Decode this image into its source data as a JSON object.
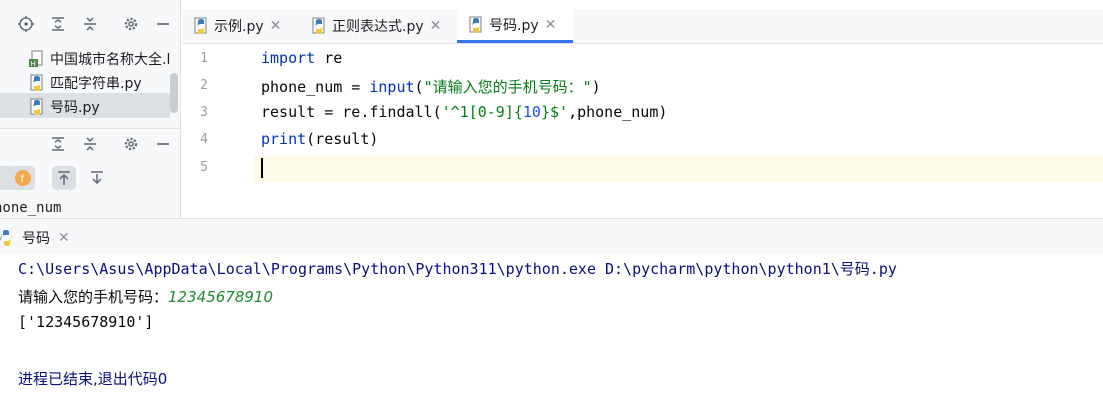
{
  "project_tree": {
    "items": [
      {
        "label": "中国城市名称大全.l",
        "icon": "text-file-icon"
      },
      {
        "label": "匹配字符串.py",
        "icon": "python-file-icon"
      },
      {
        "label": "号码.py",
        "icon": "python-file-icon",
        "selected": true
      }
    ]
  },
  "structure": {
    "visible_text": "hone_num"
  },
  "tabs": [
    {
      "label": "示例.py",
      "icon": "python-file-icon",
      "active": false
    },
    {
      "label": "正则表达式.py",
      "icon": "python-file-icon",
      "active": false
    },
    {
      "label": "号码.py",
      "icon": "python-file-icon",
      "active": true
    }
  ],
  "editor": {
    "line_numbers": [
      "1",
      "2",
      "3",
      "4",
      "5"
    ],
    "lines": [
      "import re",
      "phone_num = input(\"请输入您的手机号码：\")",
      "result = re.findall('^1[0-9]{10}$',phone_num)",
      "print(result)",
      ""
    ],
    "tokens": {
      "l1_kw": "import",
      "l1_rest": " re",
      "l2_a": "phone_num = ",
      "l2_fn": "input",
      "l2_b": "(",
      "l2_str": "\"请输入您的手机号码：\"",
      "l2_c": ")",
      "l3_a": "result = re.findall(",
      "l3_s1": "'^1[0-9]{",
      "l3_num": "10",
      "l3_s2": "}$'",
      "l3_b": ",phone_num)",
      "l4_fn": "print",
      "l4_rest": "(result)"
    }
  },
  "run": {
    "tab_label": "号码",
    "command": "C:\\Users\\Asus\\AppData\\Local\\Programs\\Python\\Python311\\python.exe D:\\pycharm\\python\\python1\\号码.py",
    "prompt": "请输入您的手机号码：",
    "user_input": "12345678910",
    "result": "['12345678910']",
    "exit_message": "进程已结束,退出代码0"
  },
  "colors": {
    "accent": "#3574f0",
    "keyword": "#0033b3",
    "string": "#067d17",
    "number": "#1750eb",
    "console_input": "#1d8a2e"
  }
}
